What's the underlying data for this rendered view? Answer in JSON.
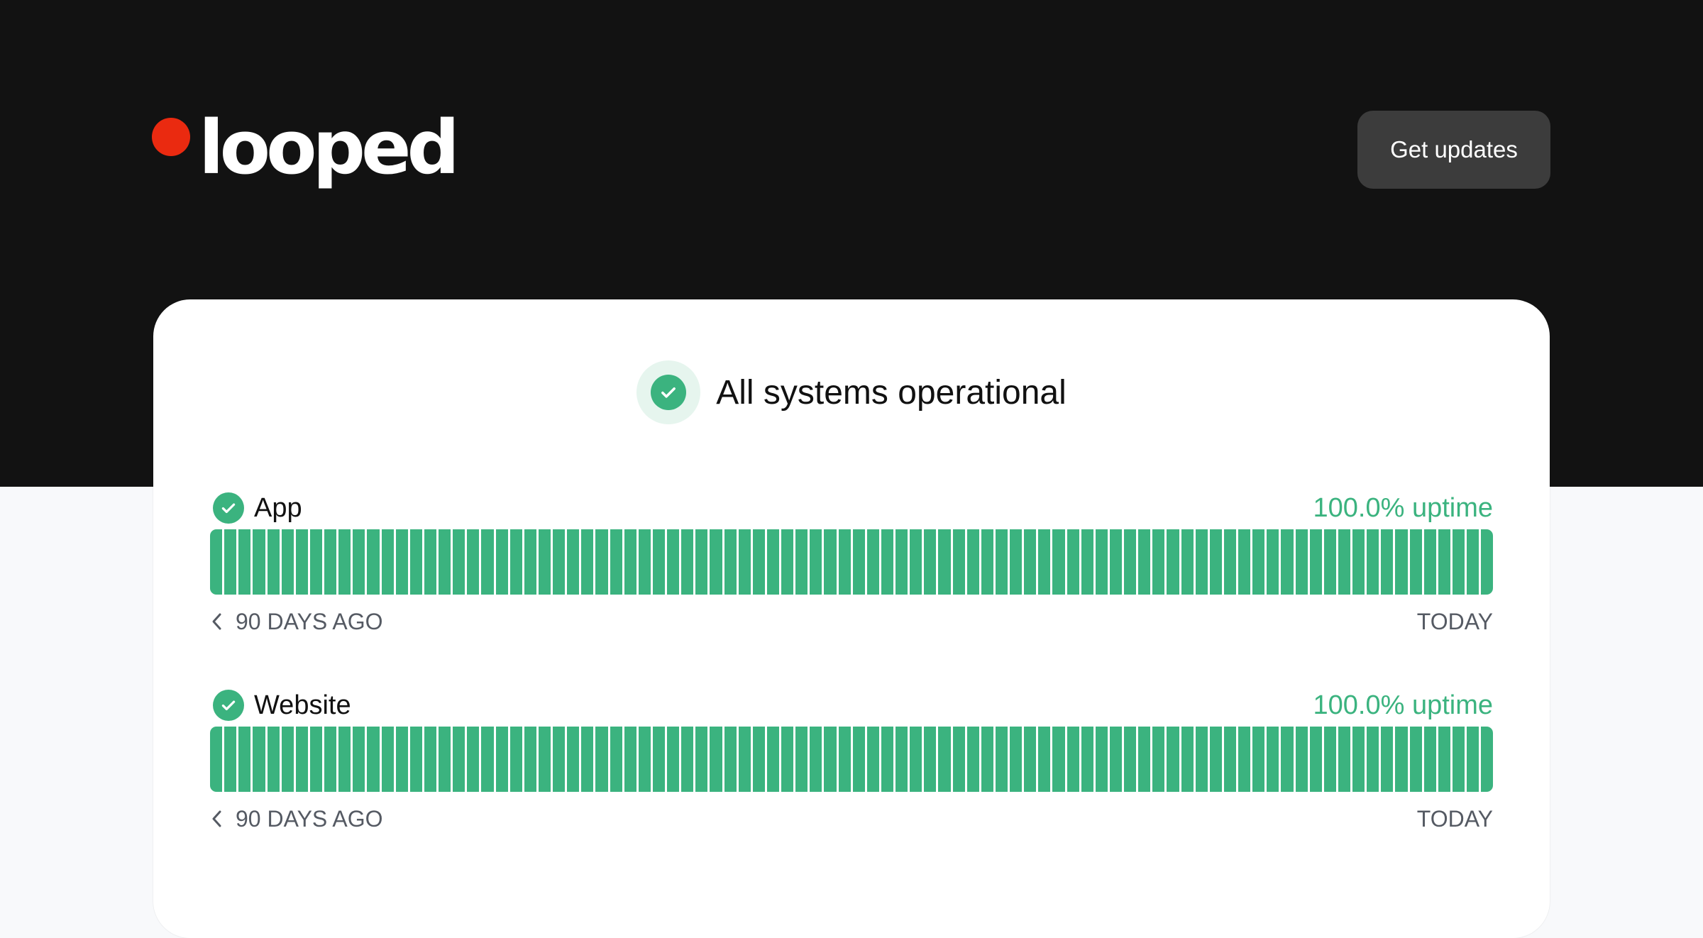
{
  "brand": {
    "name": "looped",
    "dot_color": "#ea2a10"
  },
  "header": {
    "get_updates_label": "Get updates"
  },
  "status": {
    "overall_text": "All systems operational",
    "icon": "check-circle-icon",
    "color": "#3bb37f"
  },
  "services": [
    {
      "name": "App",
      "uptime_label": "100.0% uptime",
      "uptime_percent": 100.0,
      "days": 90,
      "range_start": "90 DAYS AGO",
      "range_end": "TODAY"
    },
    {
      "name": "Website",
      "uptime_label": "100.0% uptime",
      "uptime_percent": 100.0,
      "days": 90,
      "range_start": "90 DAYS AGO",
      "range_end": "TODAY"
    }
  ]
}
